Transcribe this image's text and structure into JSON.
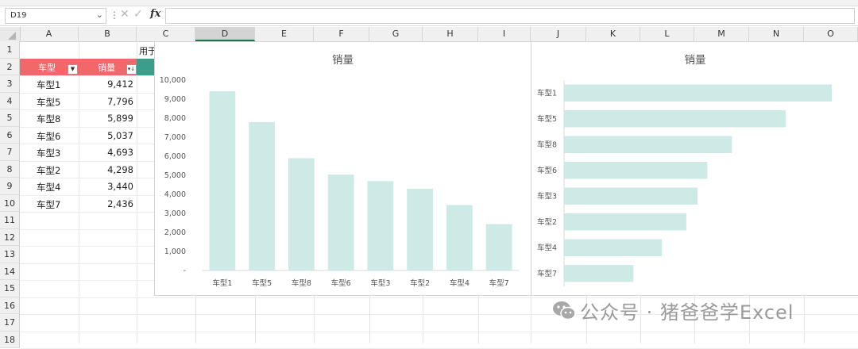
{
  "formula_bar": {
    "name_box": "D19",
    "fx_label": "fx",
    "cancel_icon": "✕",
    "enter_icon": "✓"
  },
  "columns": [
    "A",
    "B",
    "C",
    "D",
    "E",
    "F",
    "G",
    "H",
    "I",
    "J",
    "K",
    "L",
    "M",
    "N",
    "O"
  ],
  "selected_column": "D",
  "rows": [
    "1",
    "2",
    "3",
    "4",
    "5",
    "6",
    "7",
    "8",
    "9",
    "10",
    "11",
    "12",
    "13",
    "14",
    "15",
    "16",
    "17",
    "18"
  ],
  "cell_c1": "用于",
  "table": {
    "header": {
      "col_a": "车型",
      "col_b": "销量"
    },
    "rows": [
      {
        "model": "车型1",
        "sales": "9,412"
      },
      {
        "model": "车型5",
        "sales": "7,796"
      },
      {
        "model": "车型8",
        "sales": "5,899"
      },
      {
        "model": "车型6",
        "sales": "5,037"
      },
      {
        "model": "车型3",
        "sales": "4,693"
      },
      {
        "model": "车型2",
        "sales": "4,298"
      },
      {
        "model": "车型4",
        "sales": "3,440"
      },
      {
        "model": "车型7",
        "sales": "2,436"
      }
    ]
  },
  "colors": {
    "table_header": "#f2686a",
    "bar": "#cdeae6",
    "accent_cell": "#3a9e8a",
    "selected_col_border": "#217346"
  },
  "chart_data": [
    {
      "type": "bar",
      "orientation": "vertical",
      "title": "销量",
      "categories": [
        "车型1",
        "车型5",
        "车型8",
        "车型6",
        "车型3",
        "车型2",
        "车型4",
        "车型7"
      ],
      "values": [
        9412,
        7796,
        5899,
        5037,
        4693,
        4298,
        3440,
        2436
      ],
      "ylim": [
        0,
        10000
      ],
      "y_ticks": [
        "-",
        "1,000",
        "2,000",
        "3,000",
        "4,000",
        "5,000",
        "6,000",
        "7,000",
        "8,000",
        "9,000",
        "10,000"
      ],
      "grid": false,
      "legend": "none"
    },
    {
      "type": "bar",
      "orientation": "horizontal",
      "title": "销量",
      "categories": [
        "车型1",
        "车型5",
        "车型8",
        "车型6",
        "车型3",
        "车型2",
        "车型4",
        "车型7"
      ],
      "values": [
        9412,
        7796,
        5899,
        5037,
        4693,
        4298,
        3440,
        2436
      ],
      "xlim": [
        0,
        9412
      ],
      "grid": false,
      "legend": "none"
    }
  ],
  "watermark": {
    "text": "公众号 · 猪爸爸学Excel",
    "icon": "wechat-icon"
  }
}
